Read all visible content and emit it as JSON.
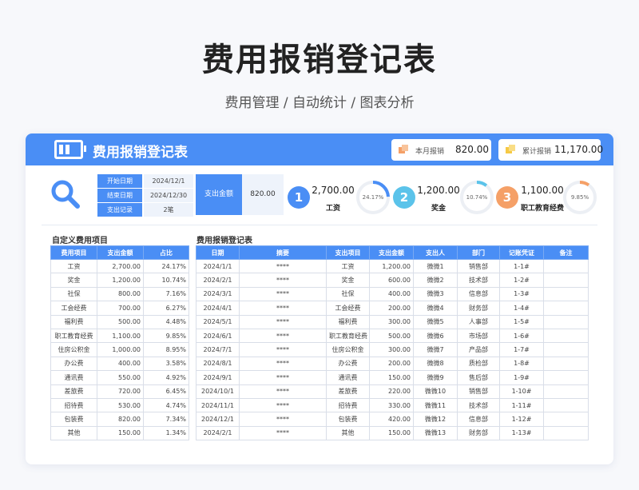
{
  "page": {
    "title": "费用报销登记表",
    "subtitle": "费用管理  /  自动统计  /  图表分析"
  },
  "header": {
    "title": "费用报销登记表",
    "monthly_label": "本月报销",
    "monthly_value": "820.00",
    "total_label": "累计报销",
    "total_value": "11,170.00"
  },
  "filters": {
    "start_label": "开始日期",
    "start_value": "2024/12/1",
    "end_label": "结束日期",
    "end_value": "2024/12/30",
    "count_label": "支出记录",
    "count_value": "2笔",
    "amount_label": "支出金额",
    "amount_value": "820.00"
  },
  "kpis": [
    {
      "rank": "1",
      "amount": "2,700.00",
      "name": "工资",
      "pct_label": "24.17%",
      "pct": 0.2417,
      "color": "#4a8ef5"
    },
    {
      "rank": "2",
      "amount": "1,200.00",
      "name": "奖金",
      "pct_label": "10.74%",
      "pct": 0.1074,
      "color": "#5bc3ea"
    },
    {
      "rank": "3",
      "amount": "1,100.00",
      "name": "职工教育经费",
      "pct_label": "9.85%",
      "pct": 0.0985,
      "color": "#f5a067"
    }
  ],
  "custom": {
    "title": "自定义费用项目",
    "headers": [
      "费用项目",
      "支出金额",
      "占比"
    ],
    "rows": [
      [
        "工资",
        "2,700.00",
        "24.17%"
      ],
      [
        "奖金",
        "1,200.00",
        "10.74%"
      ],
      [
        "社保",
        "800.00",
        "7.16%"
      ],
      [
        "工会经费",
        "700.00",
        "6.27%"
      ],
      [
        "福利费",
        "500.00",
        "4.48%"
      ],
      [
        "职工教育经费",
        "1,100.00",
        "9.85%"
      ],
      [
        "住房公积金",
        "1,000.00",
        "8.95%"
      ],
      [
        "办公费",
        "400.00",
        "3.58%"
      ],
      [
        "通讯费",
        "550.00",
        "4.92%"
      ],
      [
        "差旅费",
        "720.00",
        "6.45%"
      ],
      [
        "招待费",
        "530.00",
        "4.74%"
      ],
      [
        "包装费",
        "820.00",
        "7.34%"
      ],
      [
        "其他",
        "150.00",
        "1.34%"
      ]
    ]
  },
  "records": {
    "title": "费用报销登记表",
    "headers": [
      "日期",
      "摘要",
      "支出项目",
      "支出金额",
      "支出人",
      "部门",
      "记账凭证",
      "备注"
    ],
    "rows": [
      [
        "2024/1/1",
        "****",
        "工资",
        "1,200.00",
        "微微1",
        "销售部",
        "1-1#",
        ""
      ],
      [
        "2024/2/1",
        "****",
        "奖金",
        "600.00",
        "微微2",
        "技术部",
        "1-2#",
        ""
      ],
      [
        "2024/3/1",
        "****",
        "社保",
        "400.00",
        "微微3",
        "信息部",
        "1-3#",
        ""
      ],
      [
        "2024/4/1",
        "****",
        "工会经费",
        "200.00",
        "微微4",
        "财务部",
        "1-4#",
        ""
      ],
      [
        "2024/5/1",
        "****",
        "福利费",
        "300.00",
        "微微5",
        "人事部",
        "1-5#",
        ""
      ],
      [
        "2024/6/1",
        "****",
        "职工教育经费",
        "500.00",
        "微微6",
        "市场部",
        "1-6#",
        ""
      ],
      [
        "2024/7/1",
        "****",
        "住房公积金",
        "300.00",
        "微微7",
        "产品部",
        "1-7#",
        ""
      ],
      [
        "2024/8/1",
        "****",
        "办公费",
        "200.00",
        "微微8",
        "质检部",
        "1-8#",
        ""
      ],
      [
        "2024/9/1",
        "****",
        "通讯费",
        "150.00",
        "微微9",
        "售后部",
        "1-9#",
        ""
      ],
      [
        "2024/10/1",
        "****",
        "差旅费",
        "220.00",
        "微微10",
        "销售部",
        "1-10#",
        ""
      ],
      [
        "2024/11/1",
        "****",
        "招待费",
        "330.00",
        "微微11",
        "技术部",
        "1-11#",
        ""
      ],
      [
        "2024/12/1",
        "****",
        "包装费",
        "420.00",
        "微微12",
        "信息部",
        "1-12#",
        ""
      ],
      [
        "2024/2/1",
        "****",
        "其他",
        "150.00",
        "微微13",
        "财务部",
        "1-13#",
        ""
      ]
    ]
  }
}
